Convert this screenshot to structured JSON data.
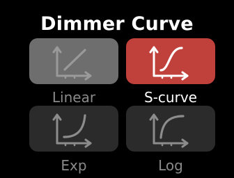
{
  "screen": {
    "title": "Dimmer Curve"
  },
  "options": [
    {
      "id": "linear",
      "label": "Linear",
      "state": "disabled",
      "icon": "linear-curve-icon"
    },
    {
      "id": "scurve",
      "label": "S-curve",
      "state": "selected",
      "icon": "s-curve-icon"
    },
    {
      "id": "exp",
      "label": "Exp",
      "state": "normal",
      "icon": "exp-curve-icon"
    },
    {
      "id": "log",
      "label": "Log",
      "state": "normal",
      "icon": "log-curve-icon"
    }
  ],
  "colors": {
    "background": "#000000",
    "title_text": "#ffffff",
    "tile_selected": "#c0403c",
    "tile_disabled": "#6e6e6e",
    "tile_normal": "#2b2b2b",
    "label_selected": "#ffffff",
    "label_muted": "#8a8a8a",
    "icon_selected": "#ffffff",
    "icon_disabled": "#9a9a9a",
    "icon_normal": "#8c8c8c"
  }
}
